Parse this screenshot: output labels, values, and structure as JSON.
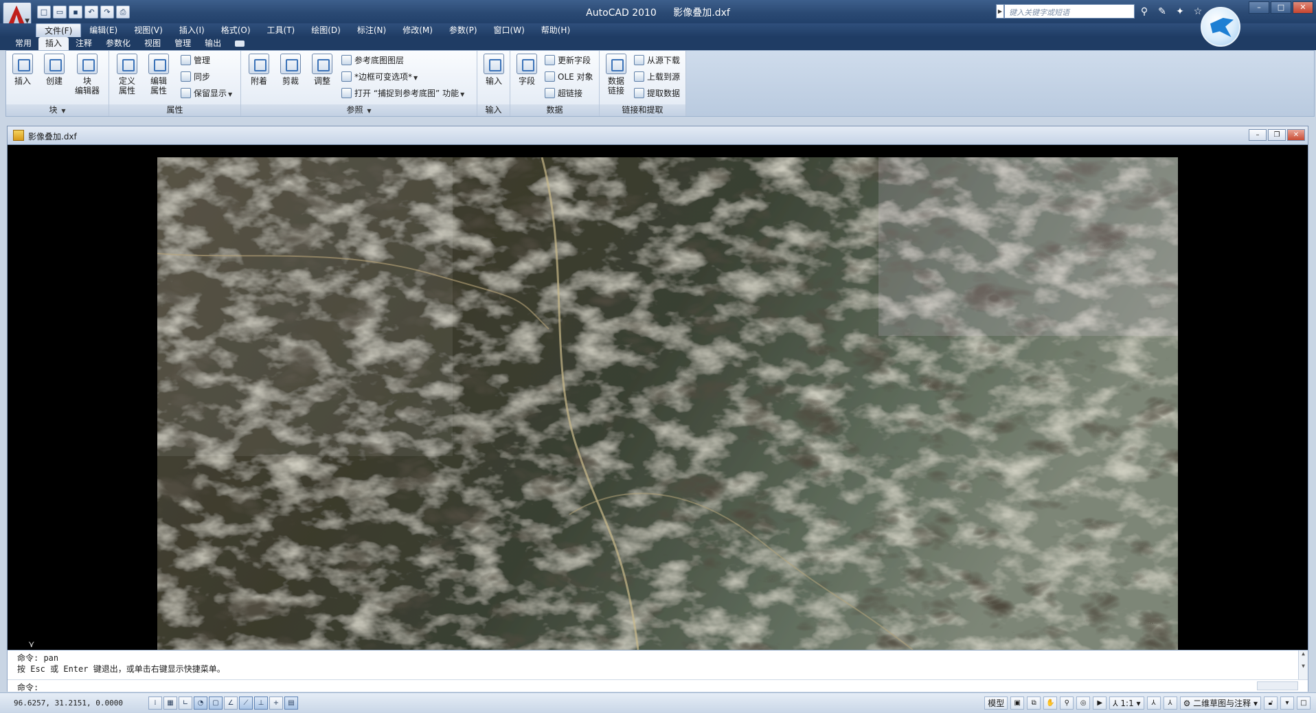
{
  "app": {
    "title_app": "AutoCAD 2010",
    "title_file": "影像叠加.dxf",
    "search_placeholder": "键入关键字或短语"
  },
  "quick_access": [
    "new-icon",
    "open-icon",
    "save-icon",
    "undo-icon",
    "redo-icon",
    "plot-icon"
  ],
  "menu": {
    "items": [
      "文件(F)",
      "编辑(E)",
      "视图(V)",
      "插入(I)",
      "格式(O)",
      "工具(T)",
      "绘图(D)",
      "标注(N)",
      "修改(M)",
      "参数(P)",
      "窗口(W)",
      "帮助(H)"
    ]
  },
  "ribbon_tabs": [
    "常用",
    "插入",
    "注释",
    "参数化",
    "视图",
    "管理",
    "输出"
  ],
  "ribbon": {
    "block": {
      "title": "块",
      "insert": "插入",
      "create": "创建",
      "editor": "块\n编辑器"
    },
    "attributes": {
      "title": "属性",
      "define": "定义\n属性",
      "edit": "编辑\n属性",
      "manage": "管理",
      "sync": "同步",
      "retain": "保留显示"
    },
    "reference": {
      "title": "参照",
      "attach": "附着",
      "clip": "剪裁",
      "adjust": "调整",
      "underlay_layers": "参考底图图层",
      "frame": "*边框可变选项*",
      "snap": "打开 “捕捉到参考底图” 功能"
    },
    "import": {
      "title": "输入",
      "import": "输入"
    },
    "data": {
      "title": "数据",
      "field": "字段",
      "update_fields": "更新字段",
      "ole": "OLE 对象",
      "hyperlink": "超链接"
    },
    "link": {
      "title": "链接和提取",
      "data_link": "数据\n链接",
      "download": "从源下载",
      "upload": "上载到源",
      "extract": "提取数据"
    }
  },
  "document": {
    "title": "影像叠加.dxf"
  },
  "command": {
    "history": [
      "命令: pan",
      "按 Esc 或 Enter 键退出，或单击右键显示快捷菜单。"
    ],
    "prompt": "命令:",
    "input_value": ""
  },
  "status": {
    "coordinates": "96.6257, 31.2151, 0.0000",
    "model_label": "模型",
    "scale_label": "1:1",
    "workspace": "二维草图与注释",
    "toggles": [
      "snap",
      "grid",
      "ortho",
      "polar",
      "osnap",
      "otrack",
      "ducs",
      "dyn",
      "lwt",
      "qp"
    ]
  },
  "colors": {
    "titlebar": "#2b4a74",
    "accent": "#1e7fd3",
    "canvas": "#000000"
  }
}
